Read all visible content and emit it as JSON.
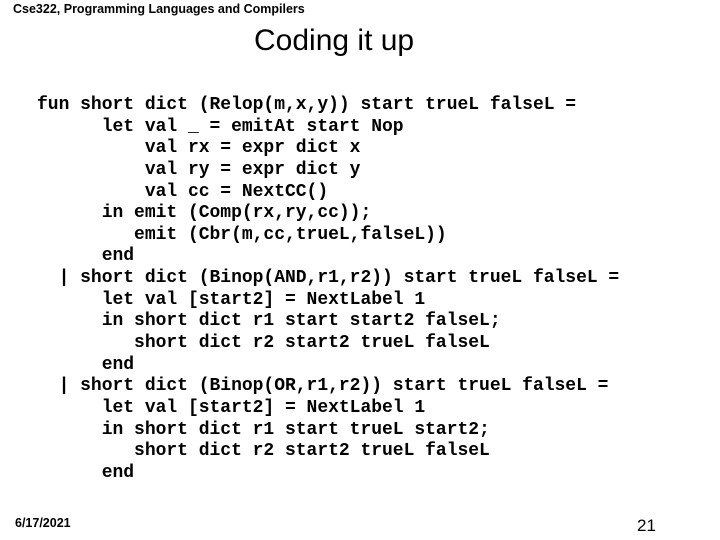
{
  "header": {
    "course": "Cse322, Programming Languages and Compilers"
  },
  "slide": {
    "title": "Coding it up",
    "code_lines": [
      "fun short dict (Relop(m,x,y)) start trueL falseL =",
      "      let val _ = emitAt start Nop",
      "          val rx = expr dict x",
      "          val ry = expr dict y",
      "          val cc = NextCC()",
      "      in emit (Comp(rx,ry,cc));",
      "         emit (Cbr(m,cc,trueL,falseL))",
      "      end",
      "  | short dict (Binop(AND,r1,r2)) start trueL falseL =",
      "      let val [start2] = NextLabel 1",
      "      in short dict r1 start start2 falseL;",
      "         short dict r2 start2 trueL falseL",
      "      end",
      "  | short dict (Binop(OR,r1,r2)) start trueL falseL =",
      "      let val [start2] = NextLabel 1",
      "      in short dict r1 start trueL start2;",
      "         short dict r2 start2 trueL falseL",
      "      end"
    ]
  },
  "footer": {
    "date": "6/17/2021",
    "page_number": "21"
  }
}
